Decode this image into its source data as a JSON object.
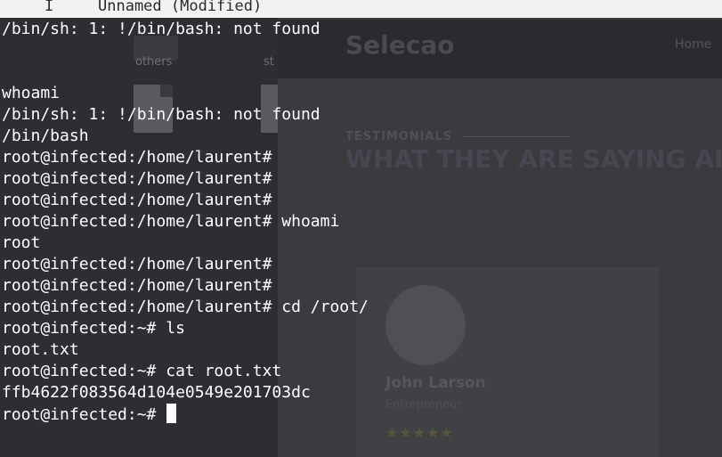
{
  "tab": {
    "indicator": "I",
    "title": "Unnamed (Modified)"
  },
  "background": {
    "file_manager": {
      "folder_label": "others",
      "folder_label_2": "st"
    },
    "website": {
      "logo": "Selecao",
      "nav_home": "Home",
      "eyebrow": "TESTIMONIALS",
      "heading": "WHAT THEY ARE SAYING AI",
      "person_name": "John Larson",
      "person_role": "Entrepreneur",
      "rating": "★★★★★"
    }
  },
  "terminal": {
    "lines": [
      "/bin/sh: 1: !/bin/bash: not found",
      "",
      "",
      "whoami",
      "/bin/sh: 1: !/bin/bash: not found",
      "/bin/bash",
      "root@infected:/home/laurent#",
      "root@infected:/home/laurent#",
      "root@infected:/home/laurent#",
      "root@infected:/home/laurent# whoami",
      "root",
      "root@infected:/home/laurent#",
      "root@infected:/home/laurent#",
      "root@infected:/home/laurent# cd /root/",
      "root@infected:~# ls",
      "root.txt",
      "root@infected:~# cat root.txt",
      "ffb4622f083564d104e0549e201703dc"
    ],
    "prompt": "root@infected:~# "
  },
  "colors": {
    "terminal_text": "#ffffff",
    "tab_bar": "#f2f2f2",
    "overlay_bg": "#26272a"
  }
}
